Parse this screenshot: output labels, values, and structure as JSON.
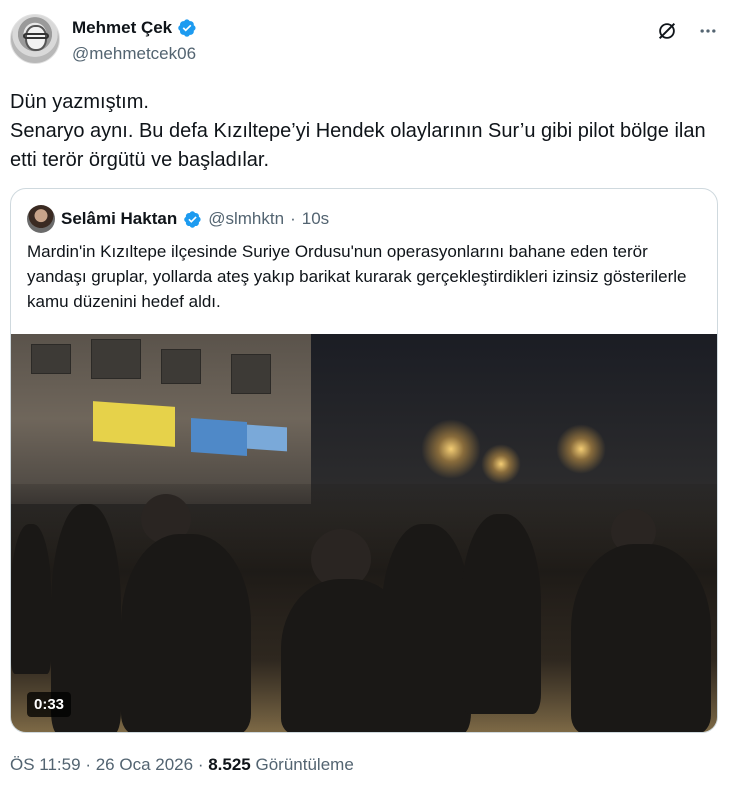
{
  "author": {
    "display_name": "Mehmet Çek",
    "handle": "@mehmetcek06",
    "verified": true,
    "avatar_icon": "profile-photo"
  },
  "header_actions": {
    "grok_icon": "grok-icon",
    "more_icon": "more-icon"
  },
  "tweet": {
    "text": "Dün yazmıştım.\nSenaryo aynı. Bu defa Kızıltepe’yi Hendek olaylarının Sur’u gibi pilot bölge ilan etti terör örgütü ve başladılar."
  },
  "quote": {
    "display_name": "Selâmi Haktan",
    "handle": "@slmhktn",
    "separator": "·",
    "time": "10s",
    "verified": true,
    "text": "Mardin'in Kızıltepe ilçesinde Suriye Ordusu'nun operasyonlarını bahane eden terör yandaşı gruplar, yollarda ateş yakıp barikat kurarak gerçekleştirdikleri izinsiz gösterilerle kamu düzenini hedef aldı.",
    "video": {
      "duration": "0:33"
    }
  },
  "footer": {
    "time": "ÖS 11:59",
    "sep1": "·",
    "date": "26 Oca 2026",
    "sep2": "·",
    "views_count": "8.525",
    "views_label": "Görüntüleme"
  },
  "colors": {
    "verified_blue": "#1d9bf0",
    "text_primary": "#0f1419",
    "text_secondary": "#536471",
    "border": "#cfd9de"
  }
}
